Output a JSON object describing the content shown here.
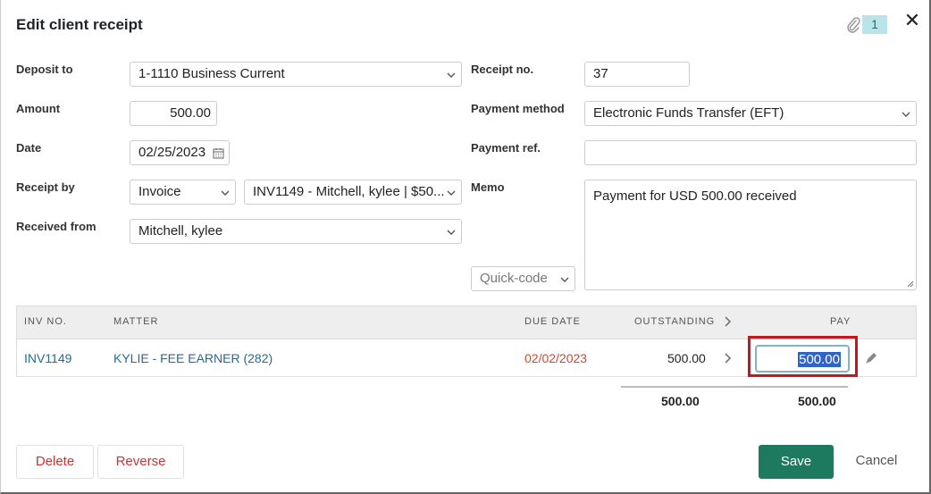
{
  "dialog": {
    "title": "Edit client receipt",
    "attachment_count": "1",
    "close_glyph": "✕"
  },
  "form": {
    "deposit_to": {
      "label": "Deposit to",
      "value": "1-1110 Business Current"
    },
    "receipt_no": {
      "label": "Receipt no.",
      "value": "37"
    },
    "amount": {
      "label": "Amount",
      "value": "500.00"
    },
    "payment_method": {
      "label": "Payment method",
      "value": "Electronic Funds Transfer (EFT)"
    },
    "date": {
      "label": "Date",
      "value": "02/25/2023"
    },
    "payment_ref": {
      "label": "Payment ref.",
      "value": ""
    },
    "receipt_by": {
      "label": "Receipt by",
      "type_value": "Invoice",
      "invoice_value": "INV1149 - Mitchell, kylee | $50..."
    },
    "memo": {
      "label": "Memo",
      "value": "Payment for USD 500.00 received"
    },
    "received_from": {
      "label": "Received from",
      "value": "Mitchell, kylee"
    },
    "quick_code": {
      "placeholder": "Quick-code"
    }
  },
  "table": {
    "headers": {
      "inv_no": "INV NO.",
      "matter": "MATTER",
      "due_date": "DUE DATE",
      "outstanding": "OUTSTANDING",
      "pay": "PAY"
    },
    "rows": [
      {
        "inv_no": "INV1149",
        "matter": "KYLIE - FEE EARNER (282)",
        "due_date": "02/02/2023",
        "outstanding": "500.00",
        "pay": "500.00"
      }
    ],
    "totals": {
      "outstanding": "500.00",
      "pay": "500.00"
    }
  },
  "buttons": {
    "delete": "Delete",
    "reverse": "Reverse",
    "save": "Save",
    "cancel": "Cancel"
  },
  "colors": {
    "save_bg": "#1e7a5e",
    "due_date": "#d9442c",
    "link": "#2a6a8a",
    "highlight_border": "#c8141e"
  },
  "icons": [
    "paperclip-icon",
    "close-icon",
    "chevron-down-icon",
    "calendar-icon",
    "chevron-right-icon",
    "pencil-icon"
  ]
}
